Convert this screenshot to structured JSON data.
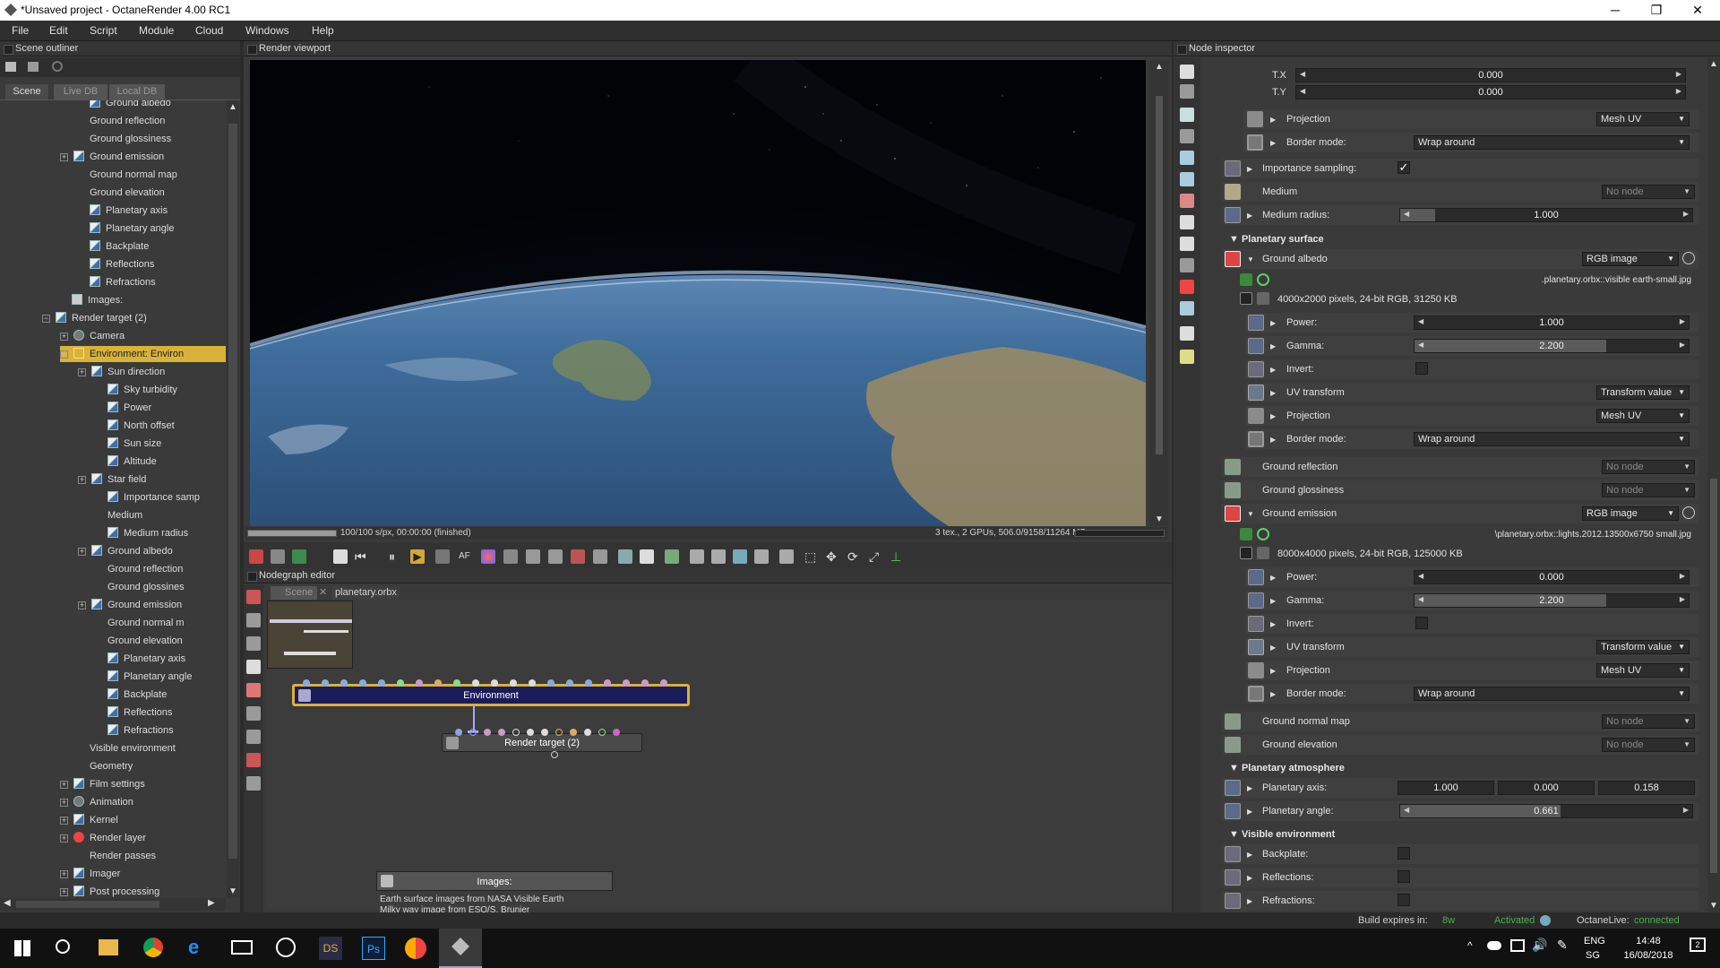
{
  "window": {
    "title": "*Unsaved project - OctaneRender 4.00 RC1"
  },
  "menu": [
    "File",
    "Edit",
    "Script",
    "Module",
    "Cloud",
    "Windows",
    "Help"
  ],
  "outliner": {
    "title": "Scene outliner",
    "tabs": [
      "Scene",
      "Live DB",
      "Local DB"
    ],
    "items": [
      "Ground albedo",
      "Ground reflection",
      "Ground glossiness",
      "Ground emission",
      "Ground normal map",
      "Ground elevation",
      "Planetary axis",
      "Planetary angle",
      "Backplate",
      "Reflections",
      "Refractions",
      "Images:",
      "Render target (2)",
      "Camera",
      "Environment: Environ",
      "Sun direction",
      "Sky turbidity",
      "Power",
      "North offset",
      "Sun size",
      "Altitude",
      "Star field",
      "Importance samp",
      "Medium",
      "Medium radius",
      "Ground albedo",
      "Ground reflection",
      "Ground glossines",
      "Ground emission",
      "Ground normal m",
      "Ground elevation",
      "Planetary axis",
      "Planetary angle",
      "Backplate",
      "Reflections",
      "Refractions",
      "Visible environment",
      "Geometry",
      "Film settings",
      "Animation",
      "Kernel",
      "Render layer",
      "Render passes",
      "Imager",
      "Post processing"
    ]
  },
  "viewport": {
    "title": "Render viewport",
    "progress_text": "100/100 s/px, 00:00:00 (finished)",
    "progress": 1.0,
    "gpu_text": "3 tex., 2 GPUs, 506.0/9158/11264 MB"
  },
  "nodegraph": {
    "title": "Nodegraph editor",
    "tabs": [
      "Scene",
      "planetary.orbx"
    ],
    "env_node": "Environment",
    "rt_node": "Render target (2)",
    "comment_title": "Images:",
    "comment_lines": [
      "Earth surface images from NASA Visible Earth",
      "Milky way image from ESO/S. Brunier"
    ]
  },
  "inspector": {
    "title": "Node inspector",
    "tx_label": "T.X",
    "tx": "0.000",
    "ty_label": "T.Y",
    "ty": "0.000",
    "projection": "Projection",
    "mesh_uv": "Mesh UV",
    "border_mode": "Border mode:",
    "wrap_around": "Wrap around",
    "importance": "Importance sampling:",
    "checkmark": "✓",
    "medium": "Medium",
    "no_node": "No node",
    "medium_radius": "Medium radius:",
    "medium_radius_val": "1.000",
    "planetary_surface": "Planetary surface",
    "ground_albedo": "Ground albedo",
    "rgb_image": "RGB image",
    "albedo_file": ".planetary.orbx::visible earth-small.jpg",
    "albedo_info": "4000x2000 pixels, 24-bit RGB, 31250 KB",
    "power": "Power:",
    "albedo_power": "1.000",
    "gamma": "Gamma:",
    "gamma_val": "2.200",
    "invert": "Invert:",
    "uv_transform": "UV transform",
    "transform_value": "Transform value",
    "ground_reflection": "Ground reflection",
    "ground_glossiness": "Ground glossiness",
    "ground_emission": "Ground emission",
    "emission_file": "\\planetary.orbx::lights.2012.13500x6750 small.jpg",
    "emission_info": "8000x4000 pixels, 24-bit RGB, 125000 KB",
    "emission_power": "0.000",
    "ground_normal": "Ground normal map",
    "ground_elevation": "Ground elevation",
    "planetary_atmosphere": "Planetary atmosphere",
    "planetary_axis": "Planetary axis:",
    "axis_vals": [
      "1.000",
      "0.000",
      "0.158"
    ],
    "planetary_angle": "Planetary angle:",
    "angle_val": "0.661",
    "visible_environment": "Visible environment",
    "backplate": "Backplate:",
    "reflections": "Reflections:",
    "refractions": "Refractions:"
  },
  "status": {
    "build_label": "Build expires in:",
    "build_val": "8w",
    "activated": "Activated",
    "live_label": "OctaneLive:",
    "live_val": "connected"
  },
  "taskbar": {
    "lang": "ENG",
    "region": "SG",
    "time": "14:48",
    "date": "16/08/2018",
    "notif": "2"
  },
  "colors": {
    "accent": "#d9b23a",
    "connected": "#4caf50",
    "node_env": "#1a1d5a"
  }
}
